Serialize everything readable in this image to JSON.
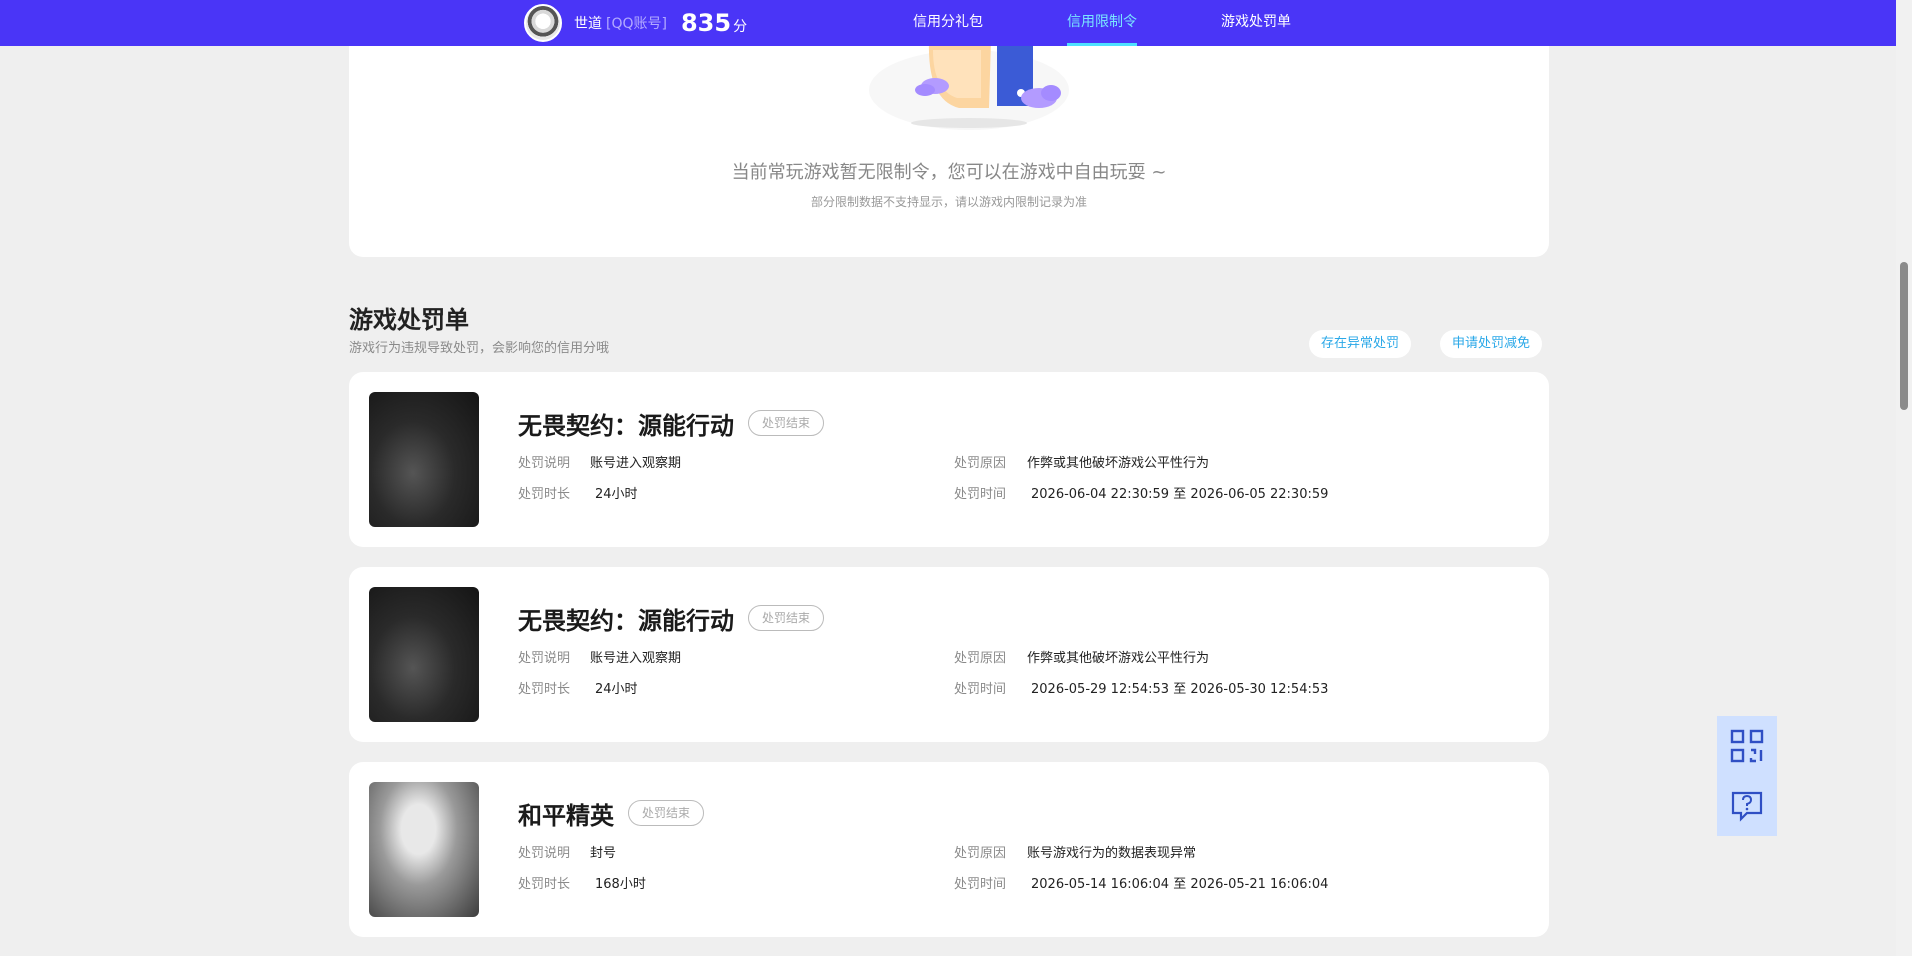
{
  "topbar": {
    "username": "世道",
    "account_type": "[QQ账号]",
    "score": "835",
    "score_unit": "分",
    "nav": [
      {
        "label": "信用分礼包"
      },
      {
        "label": "信用限制令"
      },
      {
        "label": "游戏处罚单"
      }
    ],
    "active_tab": "信用限制令",
    "bar_color": "#4a35f7"
  },
  "restriction": {
    "empty_title": "当前常玩游戏暂无限制令，您可以在游戏中自由玩耍 ~",
    "empty_sub": "部分限制数据不支持显示，请以游戏内限制记录为准"
  },
  "penalty_section": {
    "title": "游戏处罚单",
    "subtitle": "游戏行为违规导致处罚，会影响您的信用分哦",
    "buttons": [
      {
        "label": "存在异常处罚"
      },
      {
        "label": "申请处罚减免"
      }
    ]
  },
  "penalties": [
    {
      "game": "无畏契约：源能行动",
      "status": "处罚结束",
      "desc_label": "处罚说明",
      "desc": "账号进入观察期",
      "duration_label": "处罚时长",
      "duration": "24小时",
      "reason_label": "处罚原因",
      "reason": "作弊或其他破坏游戏公平性行为",
      "time_label": "处罚时间",
      "time": "2026-06-04 22:30:59 至 2026-06-05 22:30:59"
    },
    {
      "game": "无畏契约：源能行动",
      "status": "处罚结束",
      "desc_label": "处罚说明",
      "desc": "账号进入观察期",
      "duration_label": "处罚时长",
      "duration": "24小时",
      "reason_label": "处罚原因",
      "reason": "作弊或其他破坏游戏公平性行为",
      "time_label": "处罚时间",
      "time": "2026-05-29 12:54:53 至 2026-05-30 12:54:53"
    },
    {
      "game": "和平精英",
      "status": "处罚结束",
      "desc_label": "处罚说明",
      "desc": "封号",
      "duration_label": "处罚时长",
      "duration": "168小时",
      "reason_label": "处罚原因",
      "reason": "账号游戏行为的数据表现异常",
      "time_label": "处罚时间",
      "time": "2026-05-14 16:06:04 至 2026-05-21 16:06:04"
    }
  ],
  "floating": {
    "qr_icon": "qr-code-icon",
    "help_icon": "help-chat-icon"
  }
}
